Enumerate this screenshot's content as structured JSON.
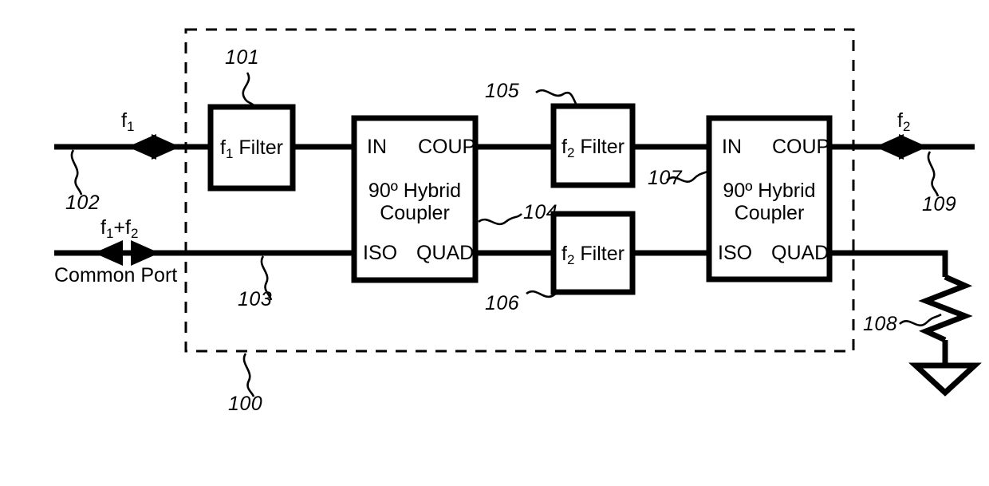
{
  "figure": {
    "title": "90 degree hybrid coupler diplexer block diagram",
    "boundary_ref": "100"
  },
  "colors": {
    "line": "#000000",
    "background": "#ffffff"
  },
  "blocks": {
    "f1_filter": {
      "label": "f₁ Filter",
      "label_main": "f",
      "label_sub": "1",
      "label_tail": " Filter",
      "ref": "101"
    },
    "f2_filter_top": {
      "label_main": "f",
      "label_sub": "2",
      "label_tail": " Filter",
      "ref": "105"
    },
    "f2_filter_bottom": {
      "label_main": "f",
      "label_sub": "2",
      "label_tail": " Filter",
      "ref": "106"
    },
    "coupler_left": {
      "name_line1": "90º Hybrid",
      "name_line2": "Coupler",
      "port_in": "IN",
      "port_coup": "COUP",
      "port_iso": "ISO",
      "port_quad": "QUAD",
      "ref": "104"
    },
    "coupler_right": {
      "name_line1": "90º Hybrid",
      "name_line2": "Coupler",
      "port_in": "IN",
      "port_coup": "COUP",
      "port_iso": "ISO",
      "port_quad": "QUAD",
      "ref": "107"
    }
  },
  "ports": {
    "input_f1": {
      "signal_main": "f",
      "signal_sub": "1",
      "ref": "102"
    },
    "common_port": {
      "signal_main": "f",
      "signal_sub1": "1",
      "signal_plus": "+f",
      "signal_sub2": "2",
      "name": "Common Port",
      "ref": "103"
    },
    "output_f2": {
      "signal_main": "f",
      "signal_sub": "2",
      "ref": "109"
    },
    "termination": {
      "ref": "108",
      "symbol": "resistor-to-ground"
    }
  },
  "refnums": {
    "r100": "100",
    "r101": "101",
    "r102": "102",
    "r103": "103",
    "r104": "104",
    "r105": "105",
    "r106": "106",
    "r107": "107",
    "r108": "108",
    "r109": "109"
  }
}
